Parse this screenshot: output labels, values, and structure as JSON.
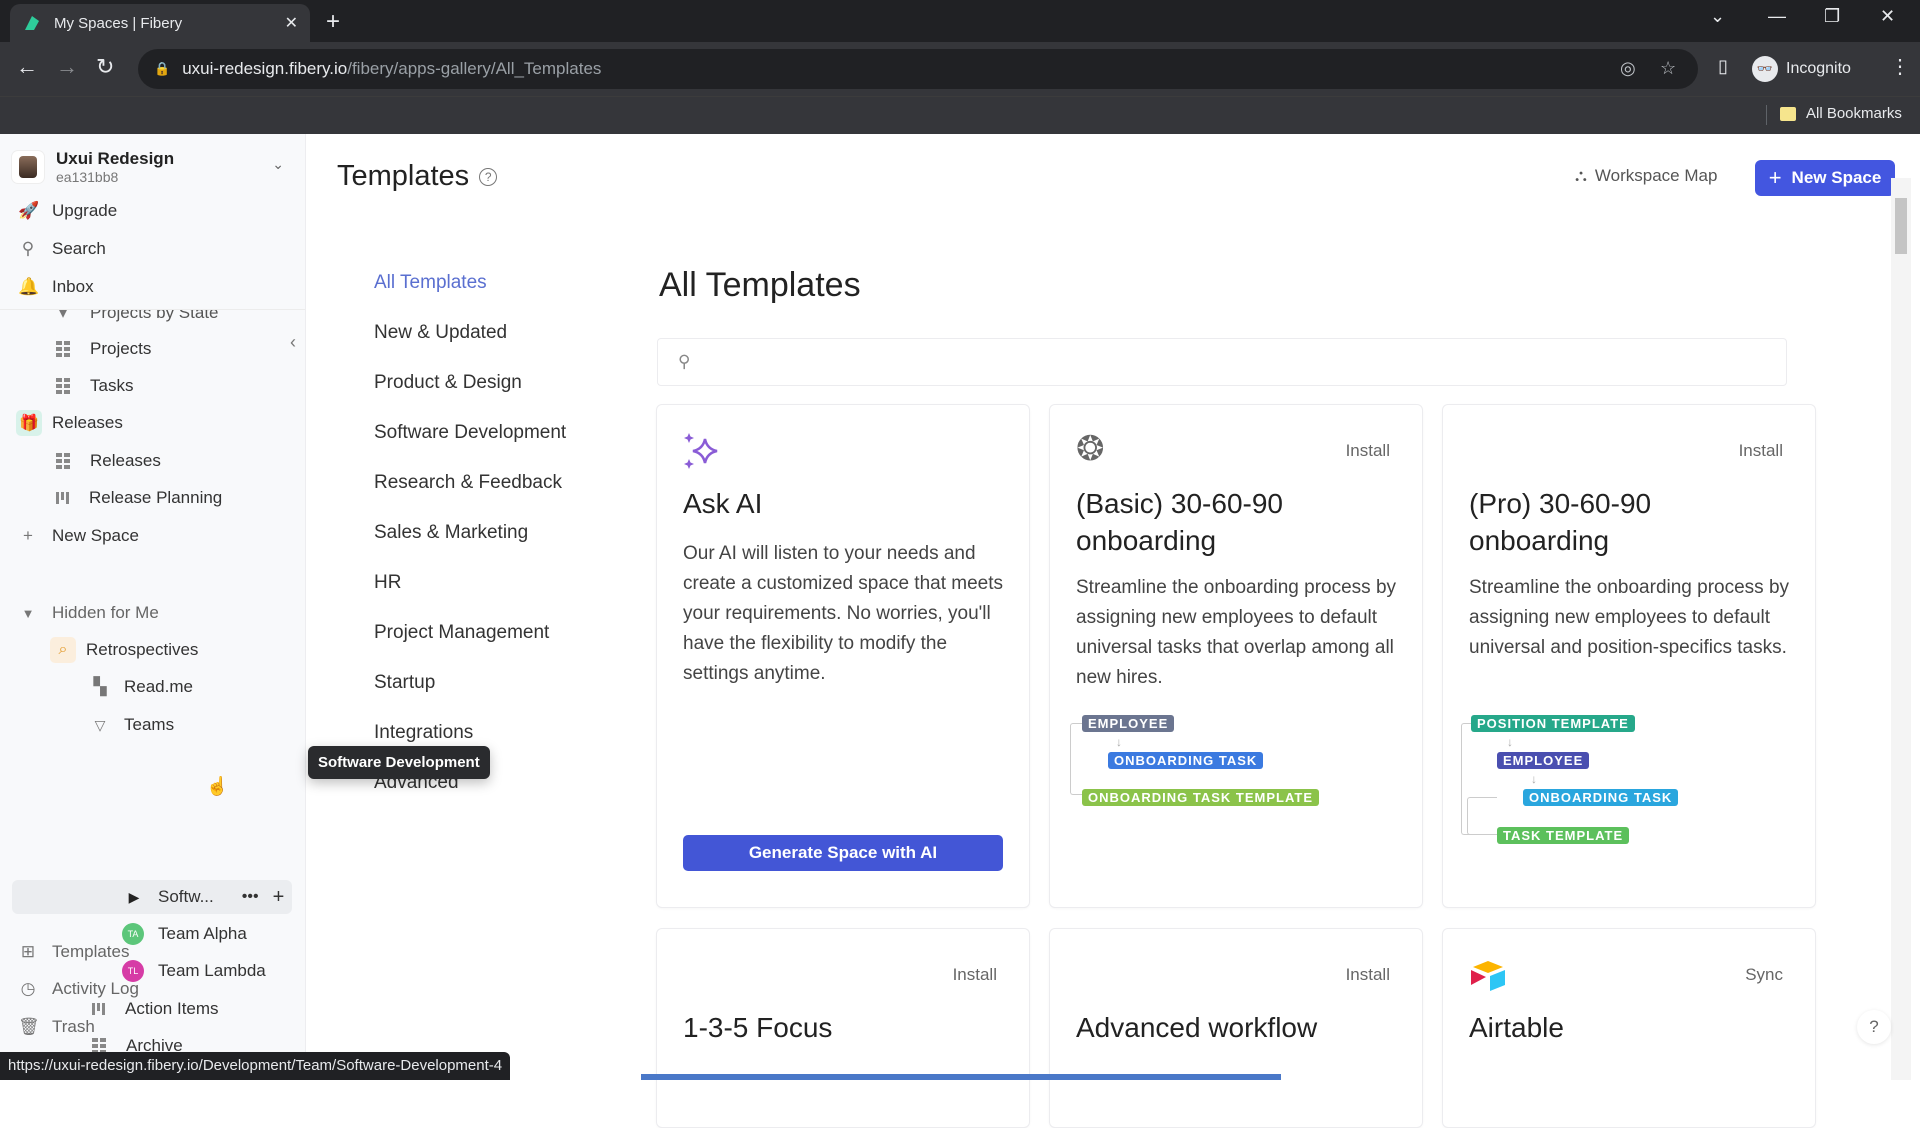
{
  "browser": {
    "tab_title": "My Spaces | Fibery",
    "url_host": "uxui-redesign.fibery.io",
    "url_path": "/fibery/apps-gallery/All_Templates",
    "profile_label": "Incognito",
    "bookmarks_label": "All Bookmarks",
    "status_url": "https://uxui-redesign.fibery.io/Development/Team/Software-Development-4"
  },
  "workspace": {
    "name": "Uxui Redesign",
    "id": "ea131bb8"
  },
  "sidebar": {
    "top_items": [
      {
        "label": "Upgrade",
        "icon": "rocket-icon"
      },
      {
        "label": "Search",
        "icon": "search-icon"
      },
      {
        "label": "Inbox",
        "icon": "bell-icon"
      }
    ],
    "partial_item": "Projects by State",
    "projects_views": [
      "Projects",
      "Tasks"
    ],
    "releases_space": "Releases",
    "releases_views": [
      "Releases",
      "Release Planning"
    ],
    "new_space": "New Space",
    "hidden_section": "Hidden for Me",
    "retro_space": "Retrospectives",
    "retro_readme": "Read.me",
    "teams_label": "Teams",
    "hover_item": {
      "label": "Softw...",
      "tooltip": "Software Development"
    },
    "teams": [
      {
        "label": "Team Alpha",
        "initials": "TA",
        "color": "#5cc67a"
      },
      {
        "label": "Team Lambda",
        "initials": "TL",
        "color": "#d63ca6"
      }
    ],
    "retro_views": [
      "Action Items",
      "Archive"
    ],
    "bottom_items": [
      {
        "label": "Templates",
        "icon": "templates-icon"
      },
      {
        "label": "Activity Log",
        "icon": "clock-icon"
      },
      {
        "label": "Trash",
        "icon": "trash-icon"
      }
    ]
  },
  "header": {
    "title": "Templates",
    "workspace_map": "Workspace Map",
    "new_space": "New Space"
  },
  "categories": [
    "All Templates",
    "New & Updated",
    "Product & Design",
    "Software Development",
    "Research & Feedback",
    "Sales & Marketing",
    "HR",
    "Project Management",
    "Startup",
    "Integrations",
    "Advanced"
  ],
  "active_category": "All Templates",
  "content": {
    "title": "All Templates",
    "search_placeholder": "",
    "cards": [
      {
        "title": "Ask AI",
        "description": "Our AI will listen to your needs and create a customized space that meets your requirements. No worries, you'll have the flexibility to modify the settings anytime.",
        "button": "Generate Space with AI"
      },
      {
        "title": "(Basic) 30-60-90 onboarding",
        "action": "Install",
        "description": "Streamline the onboarding process by assigning new employees to default universal tasks that overlap among all new hires.",
        "diagram": [
          {
            "label": "EMPLOYEE",
            "color": "#6b7590"
          },
          {
            "label": "ONBOARDING TASK",
            "color": "#3b7ae0"
          },
          {
            "label": "ONBOARDING TASK TEMPLATE",
            "color": "#8bc34a"
          }
        ]
      },
      {
        "title": "(Pro) 30-60-90 onboarding",
        "action": "Install",
        "description": "Streamline the onboarding process by assigning new employees to default universal and position-specifics tasks.",
        "diagram": [
          {
            "label": "POSITION TEMPLATE",
            "color": "#26a88a"
          },
          {
            "label": "EMPLOYEE",
            "color": "#4a4fb0"
          },
          {
            "label": "ONBOARDING TASK",
            "color": "#2aa6de"
          },
          {
            "label": "TASK TEMPLATE",
            "color": "#5cc05c"
          }
        ]
      },
      {
        "title": "1-3-5 Focus",
        "action": "Install"
      },
      {
        "title": "Advanced workflow",
        "action": "Install"
      },
      {
        "title": "Airtable",
        "action": "Sync"
      }
    ]
  },
  "colors": {
    "accent": "#4356e0",
    "active_category": "#5a6fd0"
  }
}
